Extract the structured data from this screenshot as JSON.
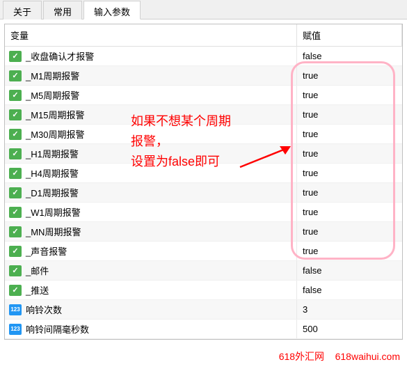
{
  "tabs": [
    {
      "label": "关于",
      "active": false
    },
    {
      "label": "常用",
      "active": false
    },
    {
      "label": "输入参数",
      "active": true
    }
  ],
  "headers": {
    "variable": "变量",
    "value": "赋值"
  },
  "rows": [
    {
      "icon": "bool",
      "name": "_收盘确认才报警",
      "value": "false"
    },
    {
      "icon": "bool",
      "name": "_M1周期报警",
      "value": "true"
    },
    {
      "icon": "bool",
      "name": "_M5周期报警",
      "value": "true"
    },
    {
      "icon": "bool",
      "name": "_M15周期报警",
      "value": "true"
    },
    {
      "icon": "bool",
      "name": "_M30周期报警",
      "value": "true"
    },
    {
      "icon": "bool",
      "name": "_H1周期报警",
      "value": "true"
    },
    {
      "icon": "bool",
      "name": "_H4周期报警",
      "value": "true"
    },
    {
      "icon": "bool",
      "name": "_D1周期报警",
      "value": "true"
    },
    {
      "icon": "bool",
      "name": "_W1周期报警",
      "value": "true"
    },
    {
      "icon": "bool",
      "name": "_MN周期报警",
      "value": "true"
    },
    {
      "icon": "bool",
      "name": "_声音报警",
      "value": "true"
    },
    {
      "icon": "bool",
      "name": "_邮件",
      "value": "false"
    },
    {
      "icon": "bool",
      "name": "_推送",
      "value": "false"
    },
    {
      "icon": "int",
      "name": "响铃次数",
      "value": "3"
    },
    {
      "icon": "int",
      "name": "响铃间隔毫秒数",
      "value": "500"
    }
  ],
  "annotation": {
    "line1": "如果不想某个周期",
    "line2": "报警，",
    "line3": "设置为false即可"
  },
  "watermark": "618外汇网    618waihui.com",
  "int_icon_text": "123"
}
